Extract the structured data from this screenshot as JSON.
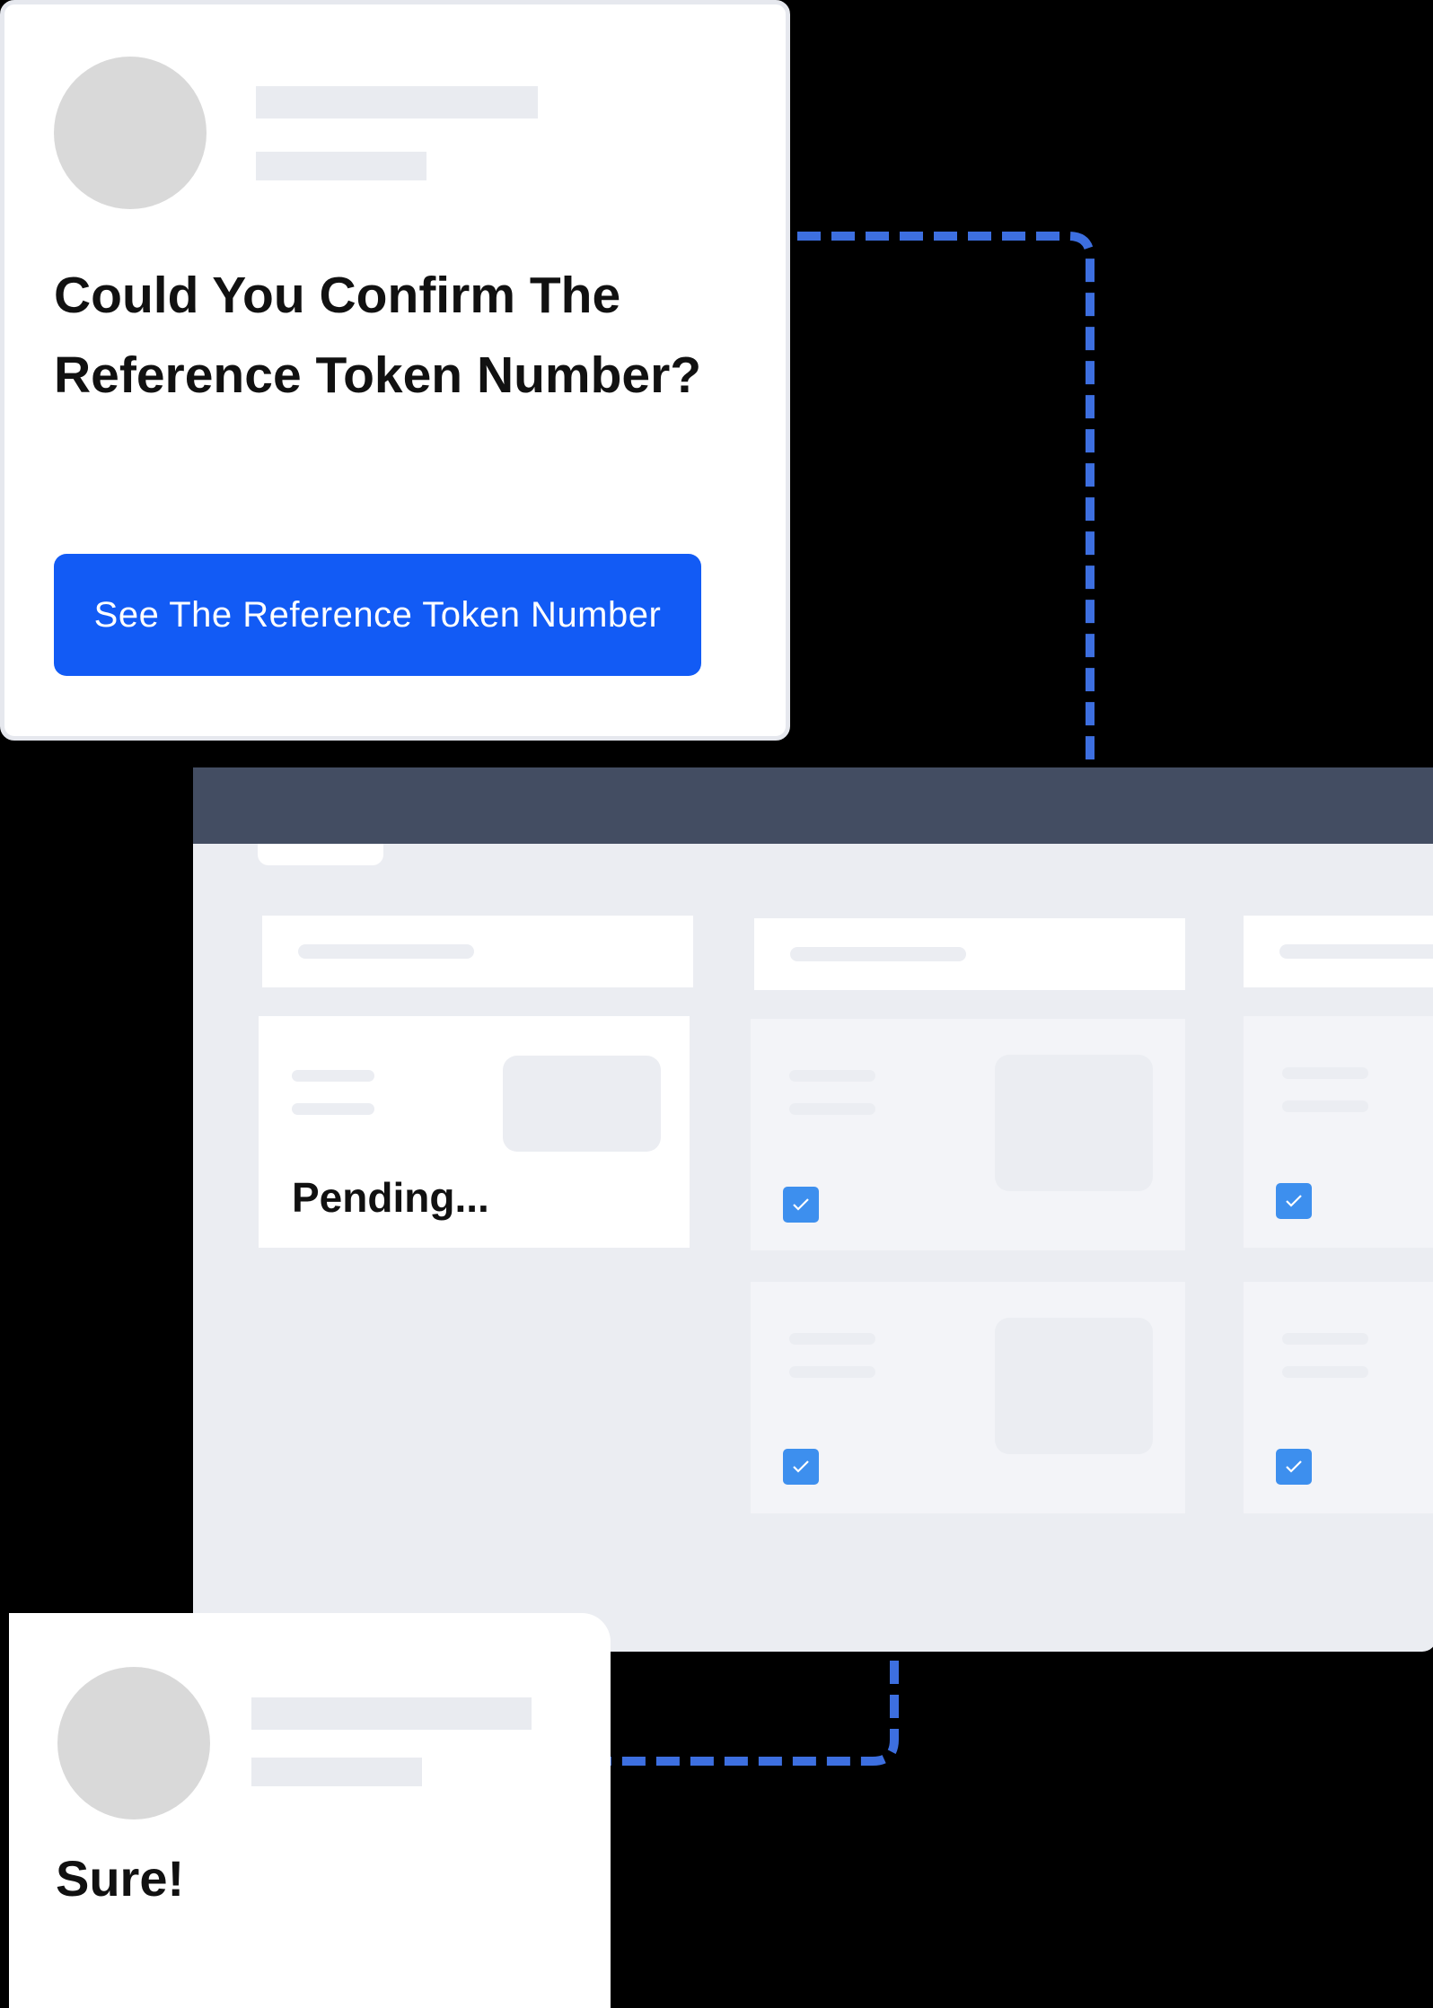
{
  "top_card": {
    "question": "Could You Confirm The Reference Token Number?",
    "button_label": "See The Reference Token Number"
  },
  "board": {
    "pending_card": {
      "status": "Pending..."
    }
  },
  "reply_card": {
    "message": "Sure!"
  },
  "colors": {
    "accent": "#125bf5",
    "connector": "#3d6fe0",
    "titlebar": "#434d62",
    "checkbox": "#3d8fee",
    "task_card_done": "#f3f4f8"
  },
  "icons": [
    "check-icon"
  ]
}
